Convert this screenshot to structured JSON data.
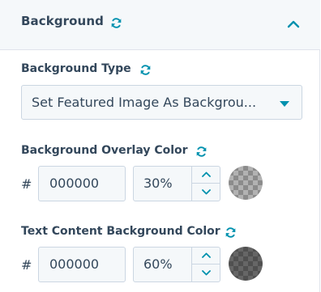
{
  "header": {
    "title": "Background"
  },
  "background_type": {
    "label": "Background Type",
    "selected": "Set Featured Image As Backgrou..."
  },
  "overlay_color": {
    "label": "Background Overlay Color",
    "hash": "#",
    "hex_value": "000000",
    "opacity": "30%",
    "opacity_fraction": 0.3,
    "swatch_color": "#000000"
  },
  "text_bg_color": {
    "label": "Text Content Background Color",
    "hash": "#",
    "hex_value": "000000",
    "opacity": "60%",
    "opacity_fraction": 0.6,
    "swatch_color": "#000000"
  },
  "colors": {
    "accent": "#0091ae",
    "text": "#33475b",
    "header_bg": "#f5f8fa",
    "border": "#cbd6e2"
  }
}
